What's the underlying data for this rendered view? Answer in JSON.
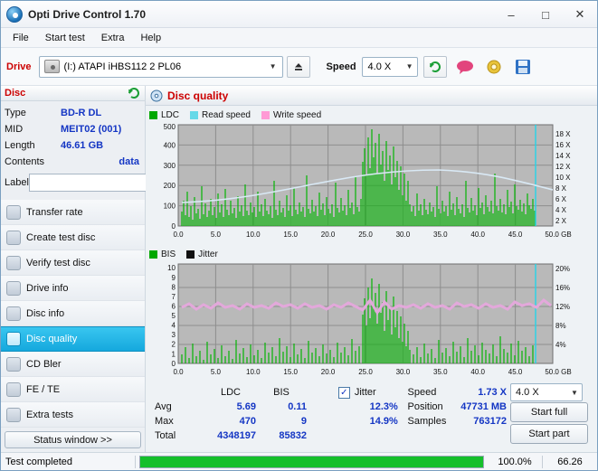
{
  "window": {
    "title": "Opti Drive Control 1.70",
    "minimize": "–",
    "maximize": "□",
    "close": "✕"
  },
  "menu": [
    "File",
    "Start test",
    "Extra",
    "Help"
  ],
  "drivebar": {
    "label": "Drive",
    "drive_value": "(I:)  ATAPI iHBS112   2  PL06",
    "eject_icon": "eject-icon",
    "speed_label": "Speed",
    "speed_value": "4.0 X",
    "refresh_icon": "refresh-icon"
  },
  "disc_panel": {
    "title": "Disc",
    "refresh_icon": "disc-refresh-icon",
    "rows": [
      {
        "key": "Type",
        "value": "BD-R DL"
      },
      {
        "key": "MID",
        "value": "MEIT02 (001)"
      },
      {
        "key": "Length",
        "value": "46.61 GB"
      },
      {
        "key": "Contents",
        "value": "data"
      }
    ],
    "label_key": "Label",
    "label_value": ""
  },
  "nav": [
    {
      "label": "Transfer rate",
      "active": false
    },
    {
      "label": "Create test disc",
      "active": false
    },
    {
      "label": "Verify test disc",
      "active": false
    },
    {
      "label": "Drive info",
      "active": false
    },
    {
      "label": "Disc info",
      "active": false
    },
    {
      "label": "Disc quality",
      "active": true
    },
    {
      "label": "CD Bler",
      "active": false
    },
    {
      "label": "FE / TE",
      "active": false
    },
    {
      "label": "Extra tests",
      "active": false
    }
  ],
  "status_window_button": "Status window >> ",
  "main": {
    "title": "Disc quality",
    "title_icon": "disc-quality-icon"
  },
  "chart_data": [
    {
      "type": "line",
      "name": "top-chart",
      "legend": [
        {
          "label": "LDC",
          "color": "#00a800"
        },
        {
          "label": "Read speed",
          "color": "#66d9e8"
        },
        {
          "label": "Write speed",
          "color": "#ff9ad5"
        }
      ],
      "xlabel": "",
      "ylabel": "",
      "x_ticks": [
        "0.0",
        "5.0",
        "10.0",
        "15.0",
        "20.0",
        "25.0",
        "30.0",
        "35.0",
        "40.0",
        "45.0",
        "50.0 GB"
      ],
      "xlim": [
        0,
        50
      ],
      "y_ticks_left": [
        "100",
        "200",
        "300",
        "400",
        "500"
      ],
      "ylim_left": [
        0,
        550
      ],
      "y_ticks_right": [
        "2 X",
        "4 X",
        "6 X",
        "8 X",
        "10 X",
        "12 X",
        "14 X",
        "16 X",
        "18 X"
      ],
      "ylim_right": [
        0,
        19
      ],
      "grid": true,
      "series": [
        {
          "name": "LDC",
          "color": "#00a800",
          "note": "dense green spikes across 0-47 GB, baseline ~40-90, tall cluster peaking ~500 near 24-26 GB"
        },
        {
          "name": "Read speed",
          "color": "#b9d9ee",
          "note": "smooth curve rising from ~4X to ~8X then falling"
        }
      ]
    },
    {
      "type": "line",
      "name": "bottom-chart",
      "legend": [
        {
          "label": "BIS",
          "color": "#00a800"
        },
        {
          "label": "Jitter",
          "color": "#111111"
        }
      ],
      "x_ticks": [
        "0.0",
        "5.0",
        "10.0",
        "15.0",
        "20.0",
        "25.0",
        "30.0",
        "35.0",
        "40.0",
        "45.0",
        "50.0 GB"
      ],
      "xlim": [
        0,
        50
      ],
      "y_ticks_left": [
        "1",
        "2",
        "3",
        "4",
        "5",
        "6",
        "7",
        "8",
        "9",
        "10"
      ],
      "ylim_left": [
        0,
        10
      ],
      "y_ticks_right": [
        "4%",
        "8%",
        "12%",
        "16%",
        "20%"
      ],
      "ylim_right": [
        0,
        21
      ],
      "grid": true,
      "series": [
        {
          "name": "BIS",
          "color": "#00a800",
          "note": "green spikes, baseline near 0-1, cluster up to ~9 near 24-26 GB"
        },
        {
          "name": "Jitter",
          "color": "#e0a8d8",
          "note": "pink band around 12-13%"
        }
      ]
    }
  ],
  "stats": {
    "col_headers": [
      "LDC",
      "BIS"
    ],
    "rows": [
      {
        "name": "Avg",
        "ldc": "5.69",
        "bis": "0.11"
      },
      {
        "name": "Max",
        "ldc": "470",
        "bis": "9"
      },
      {
        "name": "Total",
        "ldc": "4348197",
        "bis": "85832"
      }
    ],
    "jitter": {
      "checked": true,
      "label": "Jitter",
      "avg": "12.3%",
      "max": "14.9%"
    },
    "right": {
      "speed_label": "Speed",
      "speed_value": "1.73 X",
      "speed_select": "4.0 X",
      "position_label": "Position",
      "position_value": "47731 MB",
      "samples_label": "Samples",
      "samples_value": "763172",
      "start_full": "Start full",
      "start_part": "Start part"
    }
  },
  "statusbar": {
    "message": "Test completed",
    "progress_percent": 100,
    "progress_text": "100.0%",
    "time": "66.26"
  }
}
